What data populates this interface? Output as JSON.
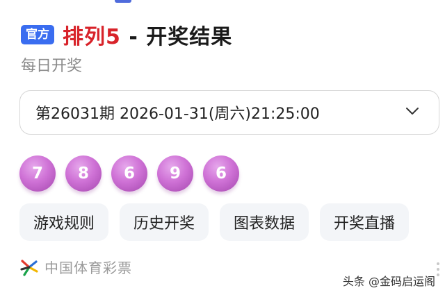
{
  "header": {
    "badge": "官方",
    "title_red": "排列5",
    "title_dark": "- 开奖结果",
    "subtitle": "每日开奖"
  },
  "draw": {
    "selected_period": "第26031期 2026-01-31(周六)21:25:00",
    "numbers": [
      "7",
      "8",
      "6",
      "9",
      "6"
    ],
    "ball_color": "#cf72d6"
  },
  "actions": [
    {
      "label": "游戏规则"
    },
    {
      "label": "历史开奖"
    },
    {
      "label": "图表数据"
    },
    {
      "label": "开奖直播"
    }
  ],
  "footer": {
    "source_label": "中国体育彩票",
    "source_icon": "lottery-logo-icon",
    "watermark": "头条 @金码启运阁"
  },
  "colors": {
    "accent_blue": "#3a6df0",
    "title_red": "#d8232a"
  }
}
